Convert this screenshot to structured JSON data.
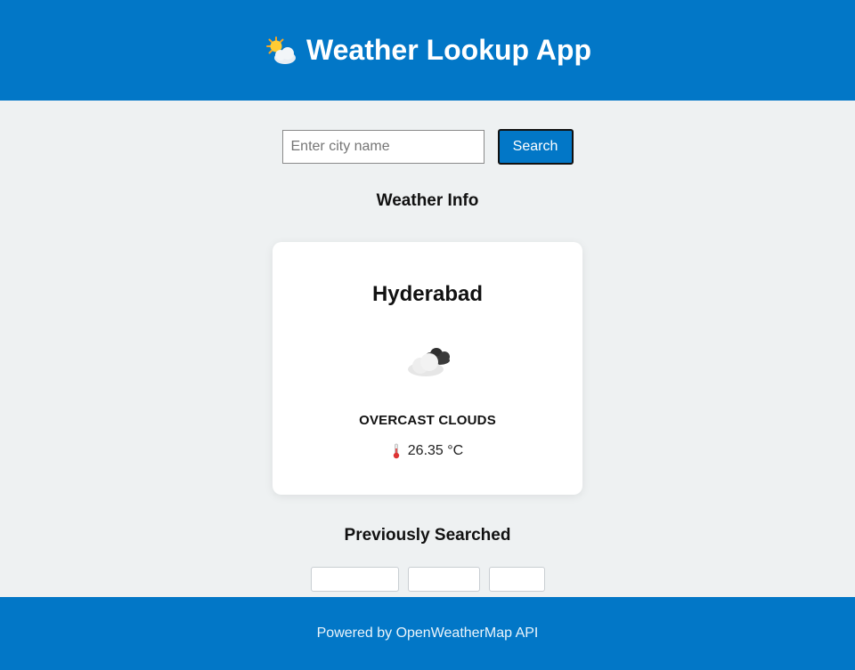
{
  "header": {
    "title": "Weather Lookup App",
    "icon": "sun-behind-cloud-icon"
  },
  "search": {
    "placeholder": "Enter city name",
    "value": "",
    "button_label": "Search"
  },
  "weather_info": {
    "section_title": "Weather Info",
    "city": "Hyderabad",
    "condition_icon": "cloud-icon",
    "condition": "OVERCAST CLOUDS",
    "temperature_icon": "thermometer-icon",
    "temperature": "26.35 °C"
  },
  "previous": {
    "section_title": "Previously Searched",
    "items": [
      "",
      "",
      ""
    ]
  },
  "footer": {
    "text": "Powered by OpenWeatherMap API"
  },
  "colors": {
    "primary": "#0277c7",
    "background": "#eef1f2",
    "card": "#ffffff"
  }
}
